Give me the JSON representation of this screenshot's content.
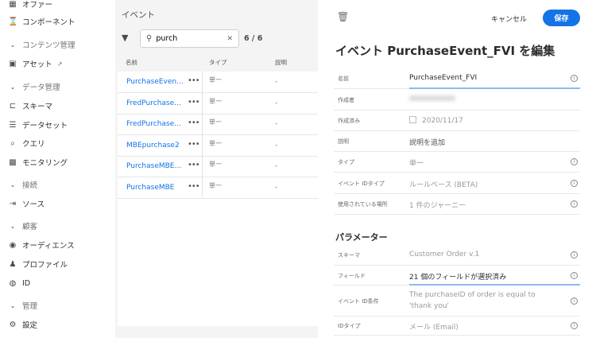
{
  "sidebar": {
    "items": [
      {
        "label": "オファー",
        "icon": "offer-icon",
        "section": false
      },
      {
        "label": "コンポーネント",
        "icon": "component-icon",
        "section": false
      },
      {
        "label": "コンテンツ管理",
        "icon": "chevron-down-icon",
        "section": true
      },
      {
        "label": "アセット",
        "icon": "asset-icon",
        "section": false,
        "external": true
      },
      {
        "label": "データ管理",
        "icon": "chevron-down-icon",
        "section": true
      },
      {
        "label": "スキーマ",
        "icon": "schema-icon",
        "section": false
      },
      {
        "label": "データセット",
        "icon": "dataset-icon",
        "section": false
      },
      {
        "label": "クエリ",
        "icon": "query-icon",
        "section": false
      },
      {
        "label": "モニタリング",
        "icon": "monitoring-icon",
        "section": false
      },
      {
        "label": "接続",
        "icon": "chevron-down-icon",
        "section": true
      },
      {
        "label": "ソース",
        "icon": "source-icon",
        "section": false
      },
      {
        "label": "顧客",
        "icon": "chevron-down-icon",
        "section": true
      },
      {
        "label": "オーディエンス",
        "icon": "audience-icon",
        "section": false
      },
      {
        "label": "プロファイル",
        "icon": "profile-icon",
        "section": false
      },
      {
        "label": "ID",
        "icon": "fingerprint-icon",
        "section": false
      },
      {
        "label": "管理",
        "icon": "chevron-down-icon",
        "section": true
      },
      {
        "label": "設定",
        "icon": "settings-icon",
        "section": false
      }
    ]
  },
  "events": {
    "title": "イベント",
    "search_value": "purch",
    "count": "6 / 6",
    "columns": [
      "名前",
      "タイプ",
      "説明"
    ],
    "rows": [
      {
        "name": "PurchaseEven...",
        "type": "単一",
        "desc": "-"
      },
      {
        "name": "FredPurchase...",
        "type": "単一",
        "desc": "-"
      },
      {
        "name": "FredPurchase...",
        "type": "単一",
        "desc": "-"
      },
      {
        "name": "MBEpurchase2",
        "type": "単一",
        "desc": "-"
      },
      {
        "name": "PurchaseMBE...",
        "type": "単一",
        "desc": "-"
      },
      {
        "name": "PurchaseMBE",
        "type": "単一",
        "desc": "-"
      }
    ]
  },
  "editor": {
    "cancel": "キャンセル",
    "save": "保存",
    "title": "イベント PurchaseEvent_FVI を編集",
    "fields": [
      {
        "label": "名前",
        "value": "PurchaseEvent_FVI"
      },
      {
        "label": "作成者",
        "value": ""
      },
      {
        "label": "作成済み",
        "value": "2020/11/17"
      },
      {
        "label": "説明",
        "value": "説明を追加"
      },
      {
        "label": "タイプ",
        "value": "単一"
      },
      {
        "label": "イベント IDタイプ",
        "value": "ルールベース (BETA)"
      },
      {
        "label": "使用されている場所",
        "value": "1 件のジャーニー"
      }
    ],
    "params_title": "パラメーター",
    "params": [
      {
        "label": "スキーマ",
        "value": "Customer Order v.1"
      },
      {
        "label": "フィールド",
        "value": "21 個のフィールドが選択済み"
      },
      {
        "label": "イベント ID条件",
        "value": "The purchaseID of order is equal to 'thank you'"
      },
      {
        "label": "IDタイプ",
        "value": "メール (Email)"
      }
    ]
  },
  "colors": {
    "accent": "#1473e6"
  }
}
